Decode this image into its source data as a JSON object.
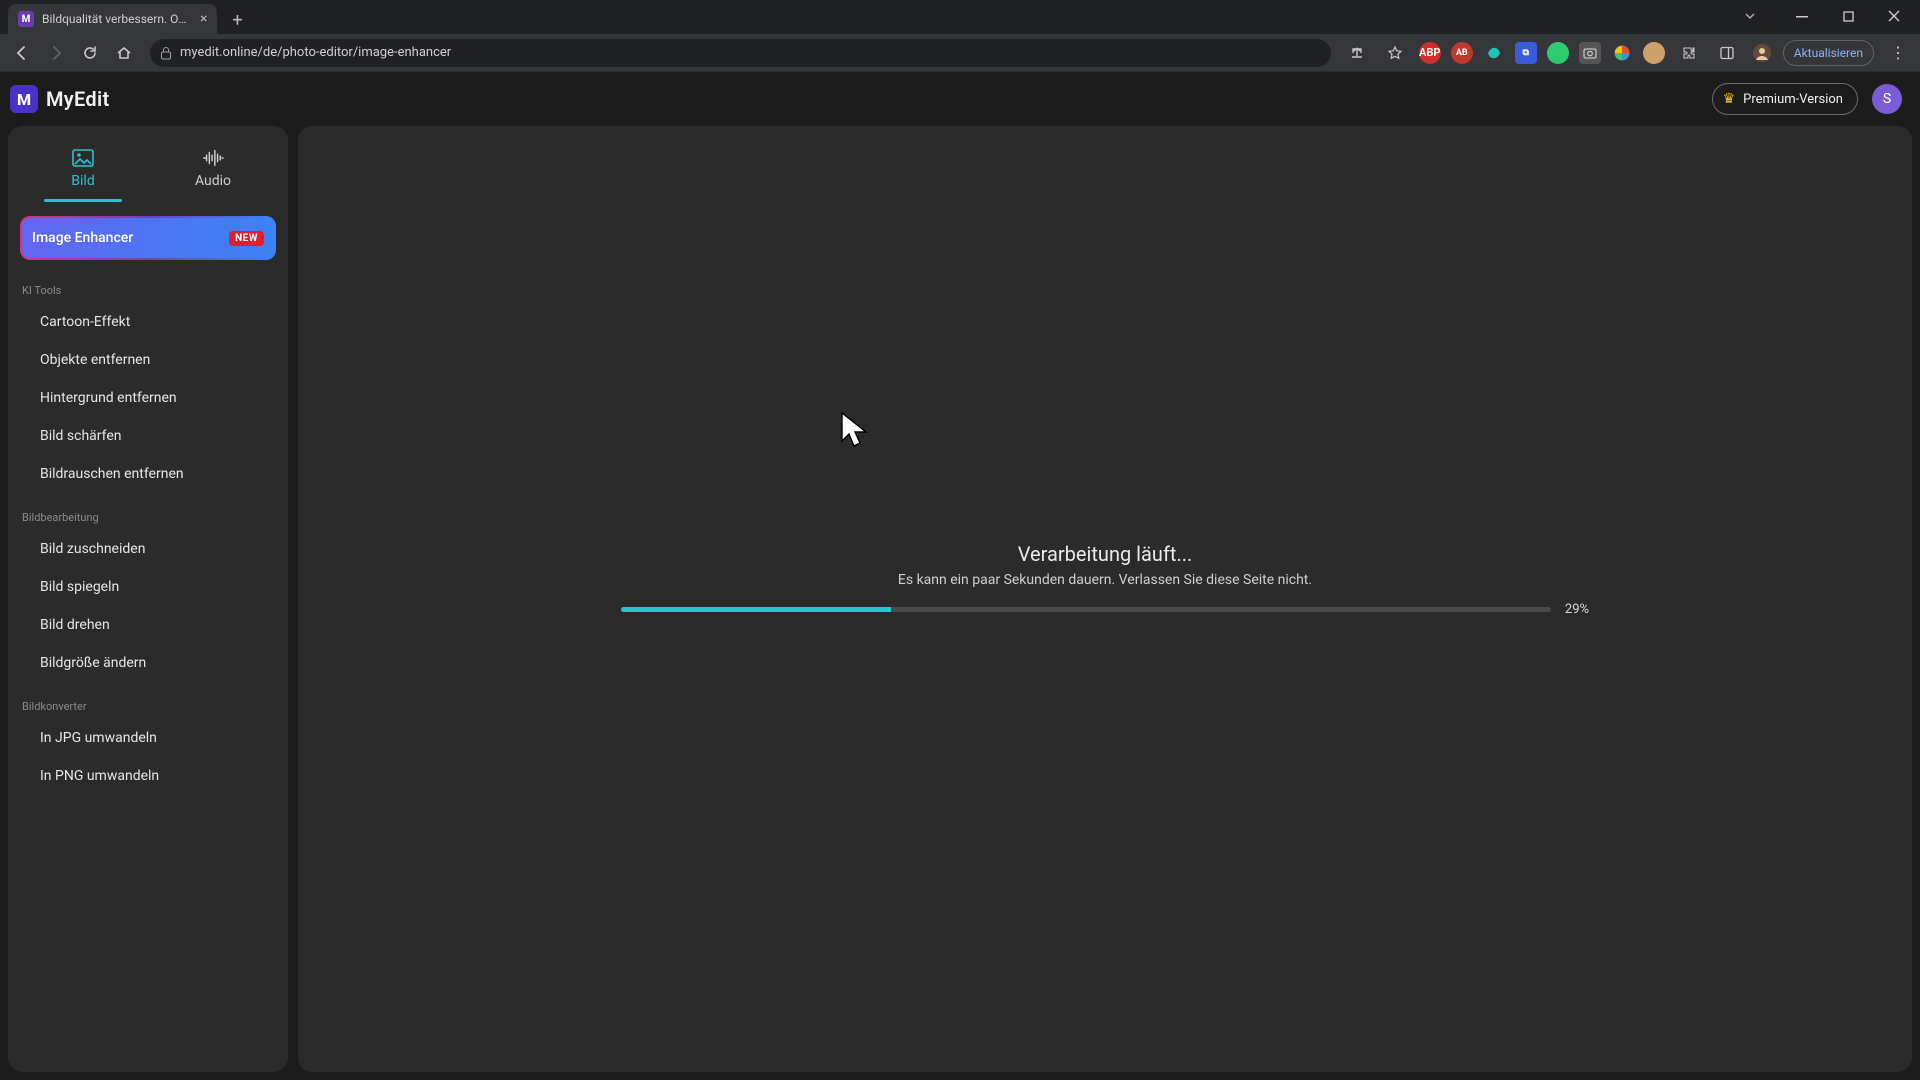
{
  "browser": {
    "tab_title": "Bildqualität verbessern. Online m",
    "url": "myedit.online/de/photo-editor/image-enhancer",
    "refresh_label": "Aktualisieren"
  },
  "header": {
    "brand_glyph": "M",
    "brand_name": "MyEdit",
    "premium_label": "Premium-Version",
    "avatar_letter": "S"
  },
  "sidebar": {
    "tabs": {
      "image": "Bild",
      "audio": "Audio"
    },
    "hero": {
      "label": "Image Enhancer",
      "badge": "NEW"
    },
    "groups": [
      {
        "title": "KI Tools",
        "items": [
          "Cartoon-Effekt",
          "Objekte entfernen",
          "Hintergrund entfernen",
          "Bild schärfen",
          "Bildrauschen entfernen"
        ]
      },
      {
        "title": "Bildbearbeitung",
        "items": [
          "Bild zuschneiden",
          "Bild spiegeln",
          "Bild drehen",
          "Bildgröße ändern"
        ]
      },
      {
        "title": "Bildkonverter",
        "items": [
          "In JPG umwandeln",
          "In PNG umwandeln"
        ]
      }
    ]
  },
  "main": {
    "progress": {
      "title": "Verarbeitung läuft...",
      "subtitle": "Es kann ein paar Sekunden dauern. Verlassen Sie diese Seite nicht.",
      "percent": 29,
      "percent_label": "29%"
    }
  },
  "colors": {
    "accent": "#2ac3d1",
    "panel": "#2b2b2b"
  }
}
